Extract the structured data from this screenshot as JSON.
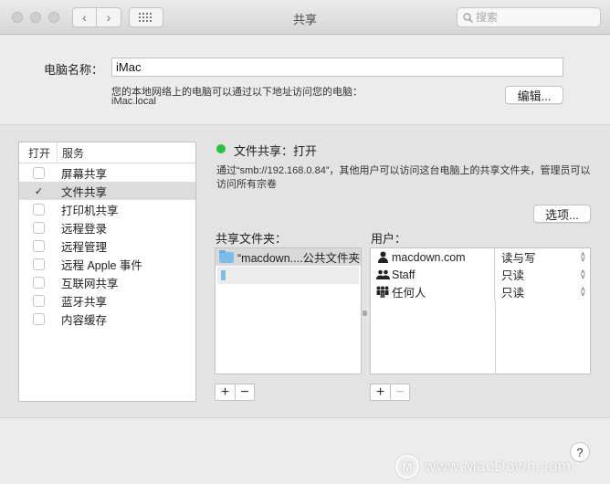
{
  "window": {
    "title": "共享"
  },
  "search": {
    "placeholder": "搜索"
  },
  "computer_name": {
    "label": "电脑名称：",
    "value": "iMac",
    "hint": "您的本地网络上的电脑可以通过以下地址访问您的电脑：",
    "address": "iMac.local",
    "edit_button": "编辑..."
  },
  "services": {
    "header_on": "打开",
    "header_service": "服务",
    "items": [
      {
        "label": "屏幕共享",
        "checked": false
      },
      {
        "label": "文件共享",
        "checked": true
      },
      {
        "label": "打印机共享",
        "checked": false
      },
      {
        "label": "远程登录",
        "checked": false
      },
      {
        "label": "远程管理",
        "checked": false
      },
      {
        "label": "远程 Apple 事件",
        "checked": false
      },
      {
        "label": "互联网共享",
        "checked": false
      },
      {
        "label": "蓝牙共享",
        "checked": false
      },
      {
        "label": "内容缓存",
        "checked": false
      }
    ],
    "check_mark": "✓"
  },
  "status": {
    "label": "文件共享：打开",
    "color": "#27c33e",
    "description": "通过“smb://192.168.0.84”，其他用户可以访问这台电脑上的共享文件夹，管理员可以访问所有宗卷"
  },
  "options_button": "选项...",
  "shared_folders": {
    "label": "共享文件夹：",
    "items": [
      "“macdown....公共文件夹"
    ]
  },
  "users": {
    "label": "用户：",
    "items": [
      {
        "name": "macdown.com",
        "permission": "读与写",
        "icon": "single-user-icon"
      },
      {
        "name": "Staff",
        "permission": "只读",
        "icon": "group-icon"
      },
      {
        "name": "任何人",
        "permission": "只读",
        "icon": "everyone-icon"
      }
    ]
  },
  "controls": {
    "plus": "+",
    "minus": "−",
    "help": "?"
  },
  "watermark": {
    "text": "www.MacDown.com",
    "logo": "M"
  }
}
